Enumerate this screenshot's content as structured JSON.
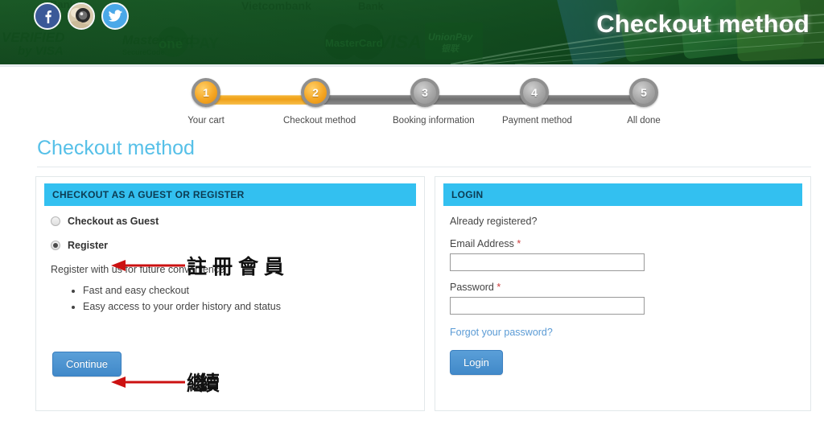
{
  "banner": {
    "title": "Checkout method",
    "social": [
      {
        "name": "facebook-icon",
        "label": "Facebook"
      },
      {
        "name": "instagram-icon",
        "label": "Instagram"
      },
      {
        "name": "twitter-icon",
        "label": "Twitter"
      }
    ],
    "background_logos": [
      "VERIFIED by VISA",
      "MasterCard SecureCode",
      "onePAY",
      "VISA",
      "MasterCard",
      "UnionPay",
      "Vietcombank",
      "Bank"
    ],
    "bg_color": "#1b5b27"
  },
  "stepper": {
    "steps": [
      {
        "number": "1",
        "label": "Your cart",
        "state": "done"
      },
      {
        "number": "2",
        "label": "Checkout method",
        "state": "done"
      },
      {
        "number": "3",
        "label": "Booking information",
        "state": "todo"
      },
      {
        "number": "4",
        "label": "Payment method",
        "state": "todo"
      },
      {
        "number": "5",
        "label": "All done",
        "state": "todo"
      }
    ],
    "active_color": "#f5a623",
    "inactive_color": "#8e8e8e"
  },
  "page": {
    "title": "Checkout method",
    "title_color": "#56c0e8"
  },
  "guest_panel": {
    "header": "CHECKOUT AS A GUEST OR REGISTER",
    "header_bg": "#33c0f0",
    "options": [
      {
        "label": "Checkout as Guest",
        "selected": false
      },
      {
        "label": "Register",
        "selected": true
      }
    ],
    "lead": "Register with us for future convenience",
    "benefits": [
      "Fast and easy checkout",
      "Easy access to your order history and status"
    ],
    "continue_label": "Continue"
  },
  "login_panel": {
    "header": "LOGIN",
    "header_bg": "#33c0f0",
    "prompt": "Already registered?",
    "email_label": "Email Address",
    "email_value": "",
    "password_label": "Password",
    "password_value": "",
    "required_marker": "*",
    "forgot_link": "Forgot your password?",
    "login_label": "Login"
  },
  "annotations": [
    {
      "name": "register-annotation",
      "text": "註冊會員",
      "color": "#cc1111",
      "points_to": "Register"
    },
    {
      "name": "continue-annotation",
      "text": "繼續",
      "color": "#cc1111",
      "points_to": "Continue"
    }
  ]
}
